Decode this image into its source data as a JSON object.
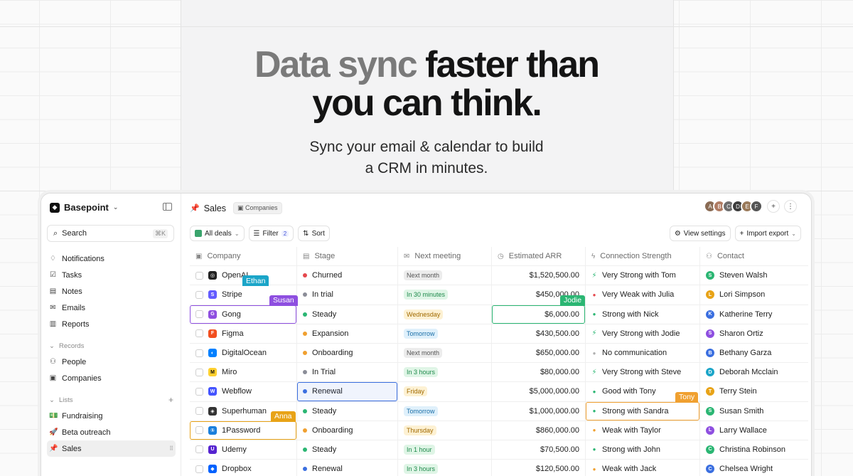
{
  "hero": {
    "headline_muted": "Data sync",
    "headline_rest": "faster than",
    "headline_line2": "you can think.",
    "sub_line1": "Sync your email & calendar to build",
    "sub_line2": "a CRM in minutes."
  },
  "sidebar": {
    "workspace": "Basepoint",
    "search_label": "Search",
    "search_shortcut": "⌘K",
    "nav": [
      {
        "label": "Notifications",
        "icon": "bell-icon",
        "glyph": "♢"
      },
      {
        "label": "Tasks",
        "icon": "checkbox-icon",
        "glyph": "☑"
      },
      {
        "label": "Notes",
        "icon": "note-icon",
        "glyph": "▤"
      },
      {
        "label": "Emails",
        "icon": "mail-icon",
        "glyph": "✉"
      },
      {
        "label": "Reports",
        "icon": "chart-icon",
        "glyph": "▥"
      }
    ],
    "records_label": "Records",
    "records": [
      {
        "label": "People",
        "icon": "people-icon",
        "glyph": "⚇"
      },
      {
        "label": "Companies",
        "icon": "building-icon",
        "glyph": "▣"
      }
    ],
    "lists_label": "Lists",
    "lists": [
      {
        "label": "Fundraising",
        "icon": "money-icon",
        "glyph": "💵"
      },
      {
        "label": "Beta outreach",
        "icon": "rocket-icon",
        "glyph": "🚀"
      },
      {
        "label": "Sales",
        "icon": "pin-icon",
        "glyph": "📌"
      }
    ]
  },
  "header": {
    "title": "Sales",
    "chip": "Companies",
    "avatars": [
      {
        "initials": "A",
        "color": "#8a6b54"
      },
      {
        "initials": "B",
        "color": "#b07c63"
      },
      {
        "initials": "C",
        "color": "#6d6d6d"
      },
      {
        "initials": "D",
        "color": "#3c3c3c"
      },
      {
        "initials": "E",
        "color": "#9a7a5a"
      },
      {
        "initials": "F",
        "color": "#555555"
      }
    ]
  },
  "toolbar": {
    "view": "All deals",
    "filter": "Filter",
    "filter_count": "2",
    "sort": "Sort",
    "view_settings": "View settings",
    "import_export": "Import export"
  },
  "columns": {
    "company": "Company",
    "stage": "Stage",
    "meeting": "Next meeting",
    "arr": "Estimated ARR",
    "conn": "Connection Strength",
    "contact": "Contact"
  },
  "rows": [
    {
      "company": "OpenAI",
      "logo": "#222222",
      "logo_char": "◎",
      "stage": "Churned",
      "stage_color": "#e5484d",
      "meeting": "Next month",
      "m_bg": "#ececec",
      "m_fg": "#555555",
      "arr": "$1,520,500.00",
      "conn": "Very Strong with Tom",
      "conn_glyph": "⚡",
      "conn_color": "#2bb673",
      "contact": "Steven Walsh",
      "c_color": "#2bb673",
      "c_init": "S"
    },
    {
      "company": "Stripe",
      "logo": "#635bff",
      "logo_char": "S",
      "stage": "In trial",
      "stage_color": "#8b8d98",
      "meeting": "In 30 minutes",
      "m_bg": "#dff5e6",
      "m_fg": "#1f8a4c",
      "arr": "$450,000.00",
      "conn": "Very Weak with Julia",
      "conn_glyph": "●",
      "conn_color": "#e5484d",
      "contact": "Lori Simpson",
      "c_color": "#e8a317",
      "c_init": "L"
    },
    {
      "company": "Gong",
      "logo": "#8e4fe0",
      "logo_char": "G",
      "stage": "Steady",
      "stage_color": "#2bb673",
      "meeting": "Wednesday",
      "m_bg": "#fdf1d3",
      "m_fg": "#a16a00",
      "arr": "$6,000.00",
      "conn": "Strong with Nick",
      "conn_glyph": "●",
      "conn_color": "#2bb673",
      "contact": "Katherine Terry",
      "c_color": "#3b6fe0",
      "c_init": "K"
    },
    {
      "company": "Figma",
      "logo": "#f24e1e",
      "logo_char": "F",
      "stage": "Expansion",
      "stage_color": "#f0a030",
      "meeting": "Tomorrow",
      "m_bg": "#dff0fb",
      "m_fg": "#1b6fa8",
      "arr": "$430,500.00",
      "conn": "Very Strong with Jodie",
      "conn_glyph": "⚡",
      "conn_color": "#2bb673",
      "contact": "Sharon Ortiz",
      "c_color": "#8e4fe0",
      "c_init": "S"
    },
    {
      "company": "DigitalOcean",
      "logo": "#0080ff",
      "logo_char": "◐",
      "stage": "Onboarding",
      "stage_color": "#f0a030",
      "meeting": "Next month",
      "m_bg": "#ececec",
      "m_fg": "#555555",
      "arr": "$650,000.00",
      "conn": "No communication",
      "conn_glyph": "●",
      "conn_color": "#b0b0b0",
      "contact": "Bethany Garza",
      "c_color": "#3b6fe0",
      "c_init": "B"
    },
    {
      "company": "Miro",
      "logo": "#ffd02f",
      "logo_char": "M",
      "stage": "In Trial",
      "stage_color": "#8b8d98",
      "meeting": "In 3 hours",
      "m_bg": "#dff5e6",
      "m_fg": "#1f8a4c",
      "arr": "$80,000.00",
      "conn": "Very Strong with Steve",
      "conn_glyph": "⚡",
      "conn_color": "#2bb673",
      "contact": "Deborah Mcclain",
      "c_color": "#1ba5c8",
      "c_init": "D"
    },
    {
      "company": "Webflow",
      "logo": "#4353ff",
      "logo_char": "W",
      "stage": "Renewal",
      "stage_color": "#3b6fe0",
      "meeting": "Friday",
      "m_bg": "#fdf1d3",
      "m_fg": "#a16a00",
      "arr": "$5,000,000.00",
      "conn": "Good with Tony",
      "conn_glyph": "●",
      "conn_color": "#2bb673",
      "contact": "Terry Stein",
      "c_color": "#e8a317",
      "c_init": "T"
    },
    {
      "company": "Superhuman",
      "logo": "#333333",
      "logo_char": "◈",
      "stage": "Steady",
      "stage_color": "#2bb673",
      "meeting": "Tomorrow",
      "m_bg": "#dff0fb",
      "m_fg": "#1b6fa8",
      "arr": "$1,000,000.00",
      "conn": "Strong with Sandra",
      "conn_glyph": "●",
      "conn_color": "#2bb673",
      "contact": "Susan Smith",
      "c_color": "#2bb673",
      "c_init": "S"
    },
    {
      "company": "1Password",
      "logo": "#1a7fdc",
      "logo_char": "①",
      "stage": "Onboarding",
      "stage_color": "#f0a030",
      "meeting": "Thursday",
      "m_bg": "#fdf1d3",
      "m_fg": "#a16a00",
      "arr": "$860,000.00",
      "conn": "Weak with Taylor",
      "conn_glyph": "●",
      "conn_color": "#f0a030",
      "contact": "Larry Wallace",
      "c_color": "#8e4fe0",
      "c_init": "L"
    },
    {
      "company": "Udemy",
      "logo": "#5624d0",
      "logo_char": "U",
      "stage": "Steady",
      "stage_color": "#2bb673",
      "meeting": "In 1 hour",
      "m_bg": "#dff5e6",
      "m_fg": "#1f8a4c",
      "arr": "$70,500.00",
      "conn": "Strong with John",
      "conn_glyph": "●",
      "conn_color": "#2bb673",
      "contact": "Christina Robinson",
      "c_color": "#2bb673",
      "c_init": "C"
    },
    {
      "company": "Dropbox",
      "logo": "#0061fe",
      "logo_char": "◆",
      "stage": "Renewal",
      "stage_color": "#3b6fe0",
      "meeting": "In 3 hours",
      "m_bg": "#dff5e6",
      "m_fg": "#1f8a4c",
      "arr": "$120,500.00",
      "conn": "Weak with Jack",
      "conn_glyph": "●",
      "conn_color": "#f0a030",
      "contact": "Chelsea Wright",
      "c_color": "#3b6fe0",
      "c_init": "C"
    }
  ],
  "collaborators": [
    {
      "name": "Ethan",
      "color": "#1ba5c8",
      "row": 1,
      "col": "company",
      "box": false,
      "offset": 74
    },
    {
      "name": "Susan",
      "color": "#8e4fe0",
      "row": 2,
      "col": "company",
      "box": true,
      "offset": 112
    },
    {
      "name": "Jodie",
      "color": "#2bb673",
      "row": 2,
      "col": "arr",
      "box": true,
      "offset": 96
    },
    {
      "name": "Renewal-select",
      "color": "#3b6fe0",
      "row": 6,
      "col": "stage",
      "box": true,
      "offset": -1
    },
    {
      "name": "Tony",
      "color": "#f0a030",
      "row": 7,
      "col": "conn",
      "box": true,
      "offset": 126
    },
    {
      "name": "Anna",
      "color": "#e8a317",
      "row": 8,
      "col": "company",
      "box": true,
      "offset": 114
    }
  ]
}
